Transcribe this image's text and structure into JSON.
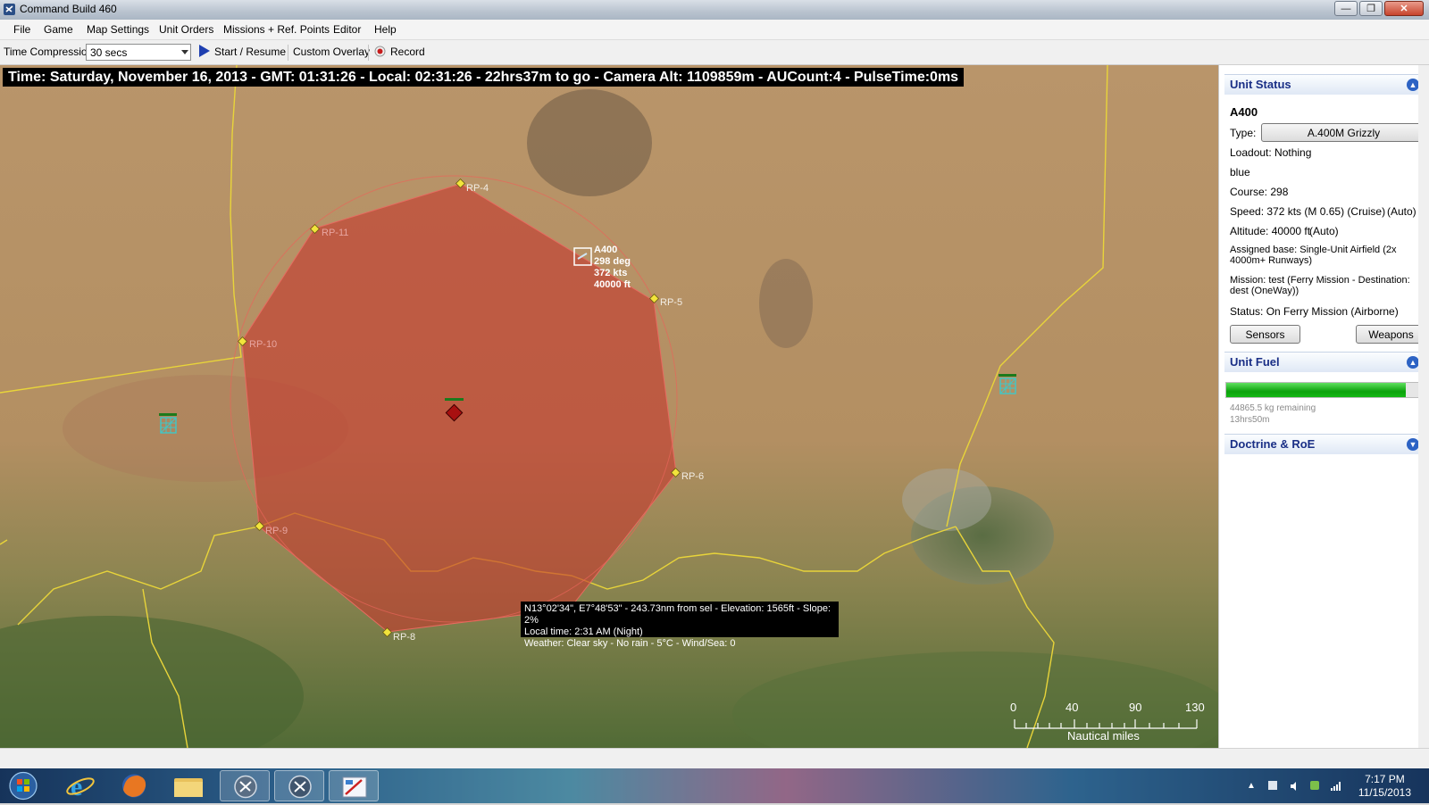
{
  "window": {
    "title": "Command Build 460"
  },
  "menu": [
    "File",
    "Game",
    "Map Settings",
    "Unit Orders",
    "Missions + Ref. Points",
    "Editor",
    "Help"
  ],
  "toolbar": {
    "time_compression_label": "Time Compression:",
    "time_compression_value": "30 secs",
    "start_resume": "Start / Resume",
    "custom_overlay": "Custom Overlay",
    "record": "Record"
  },
  "time_bar": "Time: Saturday, November 16, 2013 - GMT: 01:31:26 - Local: 02:31:26 - 22hrs37m to go -  Camera Alt: 1109859m - AUCount:4 - PulseTime:0ms",
  "map": {
    "reference_points": [
      "RP-4",
      "RP-11",
      "RP-5",
      "RP-10",
      "RP-6",
      "RP-9",
      "RP-8"
    ],
    "unit_label": {
      "name": "A400",
      "course": "298 deg",
      "speed": "372 kts",
      "altitude": "40000 ft"
    },
    "tooltip": [
      "N13°02'34\", E7°48'53\" - 243.73nm from sel - Elevation: 1565ft - Slope: 2%",
      "Local time: 2:31 AM (Night)",
      "Weather: Clear sky - No rain - 5°C - Wind/Sea: 0"
    ],
    "scale": {
      "ticks": [
        "0",
        "40",
        "90",
        "130"
      ],
      "units": "Nautical miles"
    },
    "colors": {
      "zone_fill": "#c43a2e",
      "border_line": "#e8d43a",
      "airfield_icon": "#3fc8c8",
      "rp_marker": "#f2e43c"
    }
  },
  "unit_status": {
    "header": "Unit Status",
    "name": "A400",
    "type_label": "Type:",
    "type_value": "A.400M Grizzly",
    "loadout": "Loadout: Nothing",
    "side": "blue",
    "course": "Course: 298",
    "speed": "Speed: 372 kts (M 0.65) (Cruise)",
    "speed_mode": "(Auto)",
    "altitude": "Altitude: 40000 ft",
    "altitude_mode": "(Auto)",
    "assigned_base_1": "Assigned base: Single-Unit Airfield (2x",
    "assigned_base_2": "4000m+ Runways)",
    "mission_1": "Mission: test (Ferry Mission - Destination:",
    "mission_2": "dest (OneWay))",
    "status": "Status: On Ferry Mission (Airborne)",
    "sensors_button": "Sensors",
    "weapons_button": "Weapons"
  },
  "unit_fuel": {
    "header": "Unit Fuel",
    "fuel_fraction": 0.89,
    "remaining": "44865.5 kg remaining",
    "time_left": "13hrs50m"
  },
  "doctrine": {
    "header": "Doctrine & RoE"
  },
  "taskbar": {
    "apps": [
      "start-orb",
      "internet-explorer",
      "firefox",
      "file-explorer",
      "command-app-1",
      "command-app-2",
      "paint-app"
    ],
    "clock_time": "7:17 PM",
    "clock_date": "11/15/2013"
  }
}
